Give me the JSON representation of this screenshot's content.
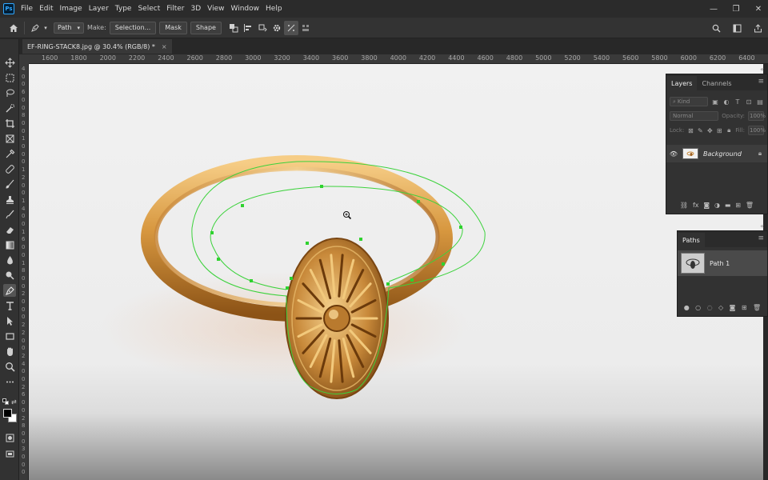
{
  "app": {
    "logo": "Ps",
    "menu": [
      "File",
      "Edit",
      "Image",
      "Layer",
      "Type",
      "Select",
      "Filter",
      "3D",
      "View",
      "Window",
      "Help"
    ]
  },
  "options": {
    "tool_mode": "Path",
    "make_label": "Make:",
    "selection_button": "Selection...",
    "mask_button": "Mask",
    "shape_button": "Shape"
  },
  "document": {
    "tab_title": "EF-RING-STACK8.jpg @ 30.4% (RGB/8) *",
    "close_glyph": "×"
  },
  "ruler": {
    "h_labels": [
      "1600",
      "1800",
      "2000",
      "2200",
      "2400",
      "2600",
      "2800",
      "3000",
      "3200",
      "3400",
      "3600",
      "3800",
      "4000",
      "4200",
      "4400",
      "4600",
      "4800",
      "5000",
      "5200",
      "5400",
      "5600",
      "5800",
      "6000",
      "6200",
      "6400"
    ],
    "v_labels": [
      "4",
      "0",
      "0",
      "6",
      "0",
      "0",
      "8",
      "0",
      "0",
      "1",
      "0",
      "0",
      "0",
      "1",
      "2",
      "0",
      "0",
      "1",
      "4",
      "0",
      "0",
      "1",
      "6",
      "0",
      "0",
      "1",
      "8",
      "0",
      "0",
      "2",
      "0",
      "0",
      "0",
      "2",
      "2",
      "0",
      "0",
      "2",
      "4",
      "0",
      "0",
      "2",
      "6",
      "0",
      "0",
      "2",
      "8",
      "0",
      "0",
      "3",
      "0",
      "0",
      "0"
    ]
  },
  "layers_panel": {
    "tabs": [
      "Layers",
      "Channels"
    ],
    "filter_kind": "Kind",
    "blend_mode": "Normal",
    "opacity_label": "Opacity:",
    "opacity_value": "100%",
    "lock_label": "Lock:",
    "fill_label": "Fill:",
    "fill_value": "100%",
    "layer_name": "Background",
    "footer_icons": [
      "link-icon",
      "fx-icon",
      "mask-icon",
      "adjustment-icon",
      "group-icon",
      "new-layer-icon",
      "trash-icon"
    ]
  },
  "paths_panel": {
    "tab": "Paths",
    "path_name": "Path 1"
  },
  "colors": {
    "accent": "#31a8ff",
    "path_stroke": "#3cd23c",
    "anchor": "#2fd22f"
  }
}
